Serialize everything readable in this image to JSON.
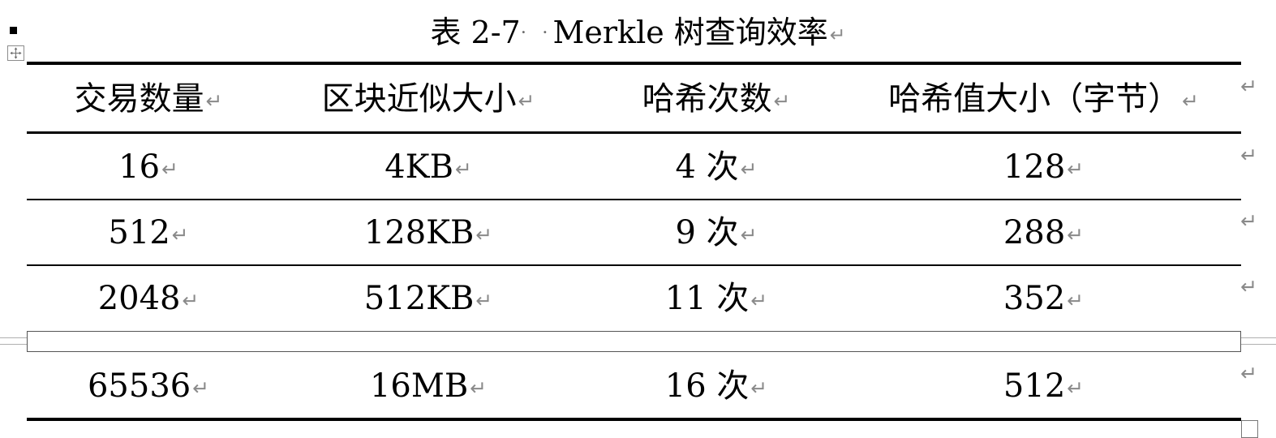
{
  "caption": {
    "prefix": "表 2-7",
    "dots": "· ·",
    "title": "Merkle 树查询效率"
  },
  "paragraph_mark": "↵",
  "table": {
    "headers": [
      "交易数量",
      "区块近似大小",
      "哈希次数",
      "哈希值大小（字节）"
    ],
    "rows": [
      [
        "16",
        "4KB",
        "4 次",
        "128"
      ],
      [
        "512",
        "128KB",
        "9 次",
        "288"
      ],
      [
        "2048",
        "512KB",
        "11 次",
        "352"
      ],
      [
        "65536",
        "16MB",
        "16 次",
        "512"
      ]
    ]
  },
  "icons": {
    "table_move_handle": "four-way-arrow-icon",
    "paragraph_bullet": "square-bullet-icon",
    "end_of_row_marker": "end-of-row-icon",
    "table_resize_handle": "resize-handle-icon"
  }
}
